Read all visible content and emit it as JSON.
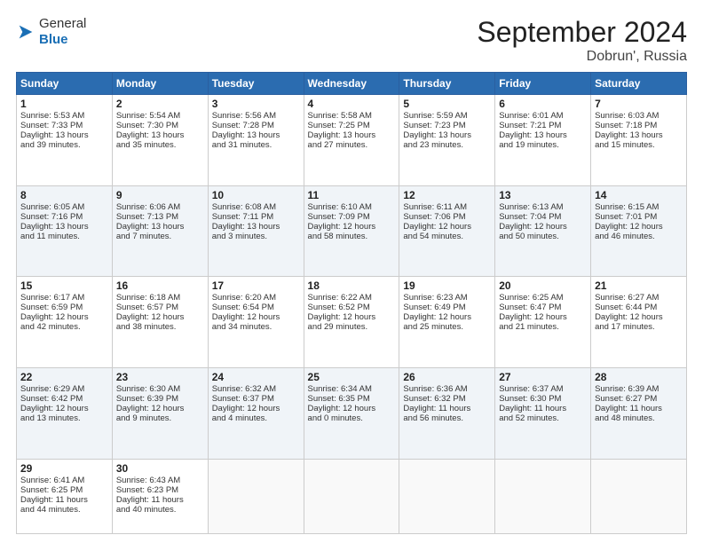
{
  "header": {
    "logo_general": "General",
    "logo_blue": "Blue",
    "month_title": "September 2024",
    "location": "Dobrun', Russia"
  },
  "weekdays": [
    "Sunday",
    "Monday",
    "Tuesday",
    "Wednesday",
    "Thursday",
    "Friday",
    "Saturday"
  ],
  "weeks": [
    [
      {
        "day": "1",
        "lines": [
          "Sunrise: 5:53 AM",
          "Sunset: 7:33 PM",
          "Daylight: 13 hours",
          "and 39 minutes."
        ]
      },
      {
        "day": "2",
        "lines": [
          "Sunrise: 5:54 AM",
          "Sunset: 7:30 PM",
          "Daylight: 13 hours",
          "and 35 minutes."
        ]
      },
      {
        "day": "3",
        "lines": [
          "Sunrise: 5:56 AM",
          "Sunset: 7:28 PM",
          "Daylight: 13 hours",
          "and 31 minutes."
        ]
      },
      {
        "day": "4",
        "lines": [
          "Sunrise: 5:58 AM",
          "Sunset: 7:25 PM",
          "Daylight: 13 hours",
          "and 27 minutes."
        ]
      },
      {
        "day": "5",
        "lines": [
          "Sunrise: 5:59 AM",
          "Sunset: 7:23 PM",
          "Daylight: 13 hours",
          "and 23 minutes."
        ]
      },
      {
        "day": "6",
        "lines": [
          "Sunrise: 6:01 AM",
          "Sunset: 7:21 PM",
          "Daylight: 13 hours",
          "and 19 minutes."
        ]
      },
      {
        "day": "7",
        "lines": [
          "Sunrise: 6:03 AM",
          "Sunset: 7:18 PM",
          "Daylight: 13 hours",
          "and 15 minutes."
        ]
      }
    ],
    [
      {
        "day": "8",
        "lines": [
          "Sunrise: 6:05 AM",
          "Sunset: 7:16 PM",
          "Daylight: 13 hours",
          "and 11 minutes."
        ]
      },
      {
        "day": "9",
        "lines": [
          "Sunrise: 6:06 AM",
          "Sunset: 7:13 PM",
          "Daylight: 13 hours",
          "and 7 minutes."
        ]
      },
      {
        "day": "10",
        "lines": [
          "Sunrise: 6:08 AM",
          "Sunset: 7:11 PM",
          "Daylight: 13 hours",
          "and 3 minutes."
        ]
      },
      {
        "day": "11",
        "lines": [
          "Sunrise: 6:10 AM",
          "Sunset: 7:09 PM",
          "Daylight: 12 hours",
          "and 58 minutes."
        ]
      },
      {
        "day": "12",
        "lines": [
          "Sunrise: 6:11 AM",
          "Sunset: 7:06 PM",
          "Daylight: 12 hours",
          "and 54 minutes."
        ]
      },
      {
        "day": "13",
        "lines": [
          "Sunrise: 6:13 AM",
          "Sunset: 7:04 PM",
          "Daylight: 12 hours",
          "and 50 minutes."
        ]
      },
      {
        "day": "14",
        "lines": [
          "Sunrise: 6:15 AM",
          "Sunset: 7:01 PM",
          "Daylight: 12 hours",
          "and 46 minutes."
        ]
      }
    ],
    [
      {
        "day": "15",
        "lines": [
          "Sunrise: 6:17 AM",
          "Sunset: 6:59 PM",
          "Daylight: 12 hours",
          "and 42 minutes."
        ]
      },
      {
        "day": "16",
        "lines": [
          "Sunrise: 6:18 AM",
          "Sunset: 6:57 PM",
          "Daylight: 12 hours",
          "and 38 minutes."
        ]
      },
      {
        "day": "17",
        "lines": [
          "Sunrise: 6:20 AM",
          "Sunset: 6:54 PM",
          "Daylight: 12 hours",
          "and 34 minutes."
        ]
      },
      {
        "day": "18",
        "lines": [
          "Sunrise: 6:22 AM",
          "Sunset: 6:52 PM",
          "Daylight: 12 hours",
          "and 29 minutes."
        ]
      },
      {
        "day": "19",
        "lines": [
          "Sunrise: 6:23 AM",
          "Sunset: 6:49 PM",
          "Daylight: 12 hours",
          "and 25 minutes."
        ]
      },
      {
        "day": "20",
        "lines": [
          "Sunrise: 6:25 AM",
          "Sunset: 6:47 PM",
          "Daylight: 12 hours",
          "and 21 minutes."
        ]
      },
      {
        "day": "21",
        "lines": [
          "Sunrise: 6:27 AM",
          "Sunset: 6:44 PM",
          "Daylight: 12 hours",
          "and 17 minutes."
        ]
      }
    ],
    [
      {
        "day": "22",
        "lines": [
          "Sunrise: 6:29 AM",
          "Sunset: 6:42 PM",
          "Daylight: 12 hours",
          "and 13 minutes."
        ]
      },
      {
        "day": "23",
        "lines": [
          "Sunrise: 6:30 AM",
          "Sunset: 6:39 PM",
          "Daylight: 12 hours",
          "and 9 minutes."
        ]
      },
      {
        "day": "24",
        "lines": [
          "Sunrise: 6:32 AM",
          "Sunset: 6:37 PM",
          "Daylight: 12 hours",
          "and 4 minutes."
        ]
      },
      {
        "day": "25",
        "lines": [
          "Sunrise: 6:34 AM",
          "Sunset: 6:35 PM",
          "Daylight: 12 hours",
          "and 0 minutes."
        ]
      },
      {
        "day": "26",
        "lines": [
          "Sunrise: 6:36 AM",
          "Sunset: 6:32 PM",
          "Daylight: 11 hours",
          "and 56 minutes."
        ]
      },
      {
        "day": "27",
        "lines": [
          "Sunrise: 6:37 AM",
          "Sunset: 6:30 PM",
          "Daylight: 11 hours",
          "and 52 minutes."
        ]
      },
      {
        "day": "28",
        "lines": [
          "Sunrise: 6:39 AM",
          "Sunset: 6:27 PM",
          "Daylight: 11 hours",
          "and 48 minutes."
        ]
      }
    ],
    [
      {
        "day": "29",
        "lines": [
          "Sunrise: 6:41 AM",
          "Sunset: 6:25 PM",
          "Daylight: 11 hours",
          "and 44 minutes."
        ]
      },
      {
        "day": "30",
        "lines": [
          "Sunrise: 6:43 AM",
          "Sunset: 6:23 PM",
          "Daylight: 11 hours",
          "and 40 minutes."
        ]
      },
      {
        "day": "",
        "lines": []
      },
      {
        "day": "",
        "lines": []
      },
      {
        "day": "",
        "lines": []
      },
      {
        "day": "",
        "lines": []
      },
      {
        "day": "",
        "lines": []
      }
    ]
  ]
}
